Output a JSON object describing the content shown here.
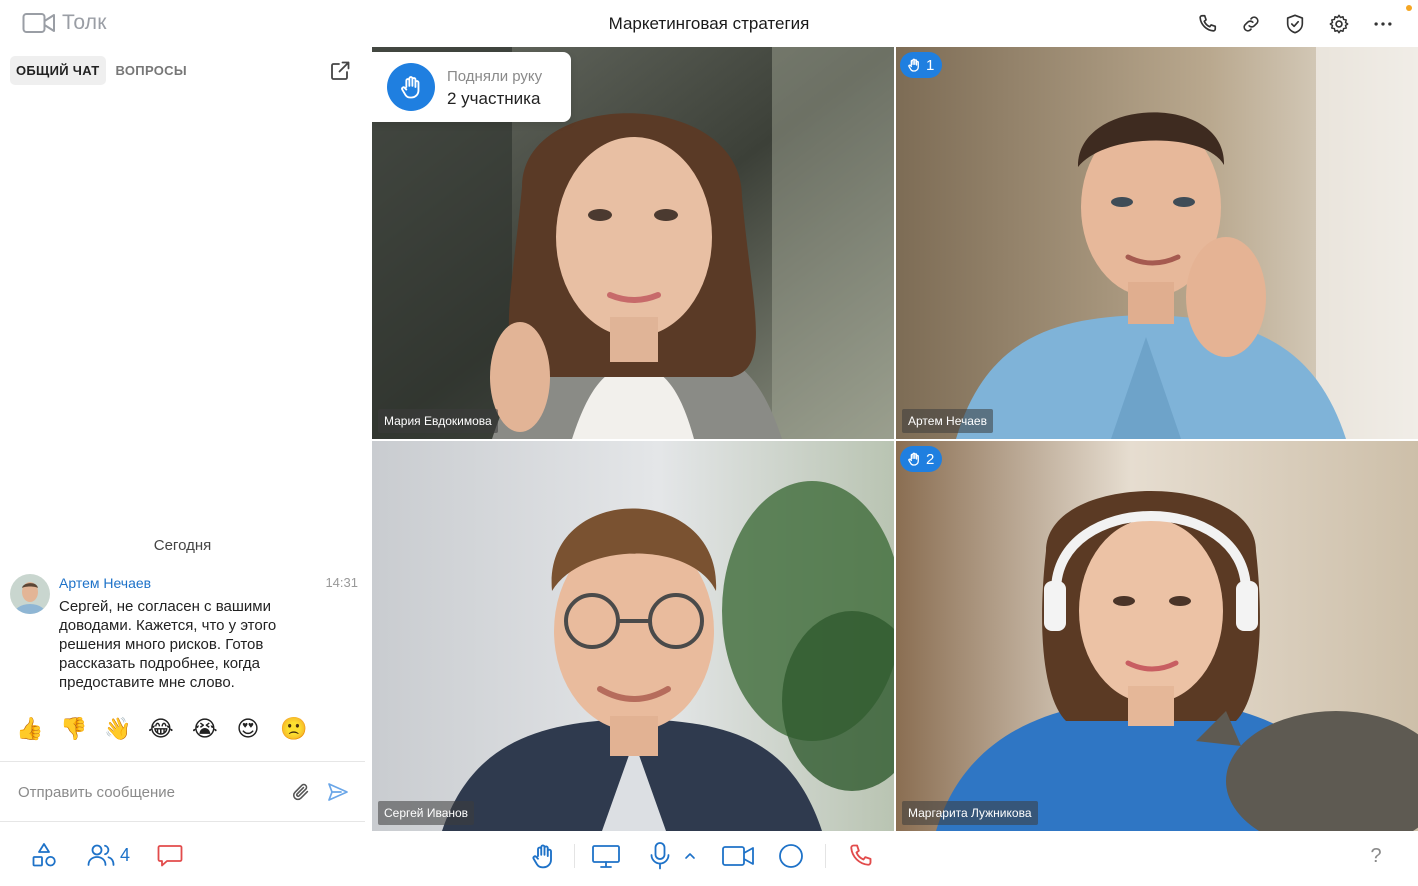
{
  "app": {
    "name": "Толк"
  },
  "call": {
    "title": "Маркетинговая стратегия"
  },
  "top_actions": [
    {
      "name": "phone-icon"
    },
    {
      "name": "link-icon"
    },
    {
      "name": "shield-check-icon"
    },
    {
      "name": "gear-icon"
    },
    {
      "name": "more-icon"
    }
  ],
  "chat": {
    "tabs": [
      {
        "label": "ОБЩИЙ ЧАТ",
        "active": true
      },
      {
        "label": "ВОПРОСЫ",
        "active": false
      }
    ],
    "day_divider": "Сегодня",
    "messages": [
      {
        "author": "Артем Нечаев",
        "time": "14:31",
        "text": "Сергей, не согласен с вашими доводами. Кажется, что у этого решения много рисков. Готов рассказать подробнее, когда предоставите мне слово."
      }
    ],
    "reactions": [
      "👍",
      "👎",
      "👋",
      "😂",
      "😭",
      "😍",
      "🙁"
    ],
    "composer": {
      "placeholder": "Отправить сообщение"
    }
  },
  "raised_hands": {
    "label": "Подняли руку",
    "count_text": "2 участника"
  },
  "participants": [
    {
      "name": "Мария Евдокимова",
      "speaking": false,
      "hand": null
    },
    {
      "name": "Артем Нечаев",
      "speaking": false,
      "hand": "1"
    },
    {
      "name": "Сергей Иванов",
      "speaking": true,
      "hand": null
    },
    {
      "name": "Маргарита Лужникова",
      "speaking": false,
      "hand": "2"
    }
  ],
  "bottom_bar": {
    "participants_count": "4",
    "help": "?"
  },
  "colors": {
    "accent": "#1f7fe0",
    "link": "#1e72c8",
    "hangup": "#e24b4b"
  }
}
